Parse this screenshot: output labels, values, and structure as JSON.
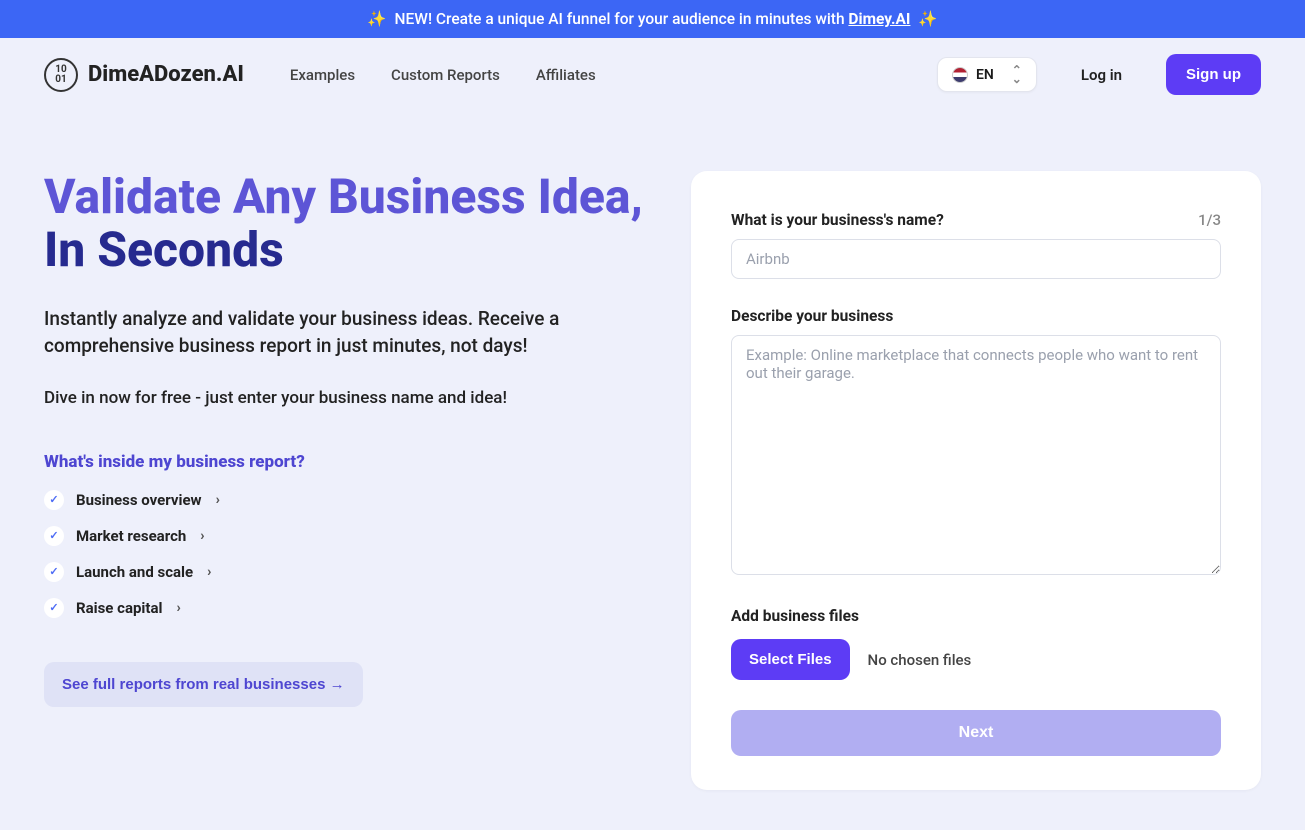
{
  "banner": {
    "prefix": "NEW! Create a unique AI funnel for your audience in minutes with ",
    "link_text": "Dimey.AI",
    "sparkle": "✨"
  },
  "brand": {
    "name": "DimeADozen.AI",
    "logo_text": "10\n01"
  },
  "nav": {
    "examples": "Examples",
    "custom_reports": "Custom Reports",
    "affiliates": "Affiliates"
  },
  "header_actions": {
    "lang_label": "EN",
    "login": "Log in",
    "signup": "Sign up"
  },
  "hero": {
    "title_a": "Validate Any Business Idea, ",
    "title_b": "In Seconds",
    "subtitle": "Instantly analyze and validate your business ideas. Receive a comprehensive business report in just minutes, not days!",
    "cta_line": "Dive in now for free - just enter your business name and idea!",
    "inside_heading": "What's inside my business report?",
    "features": [
      {
        "label": "Business overview"
      },
      {
        "label": "Market research"
      },
      {
        "label": "Launch and scale"
      },
      {
        "label": "Raise capital"
      }
    ],
    "see_full": "See full reports from real businesses →"
  },
  "form": {
    "q1_label": "What is your business's name?",
    "step_indicator": "1/3",
    "q1_placeholder": "Airbnb",
    "q2_label": "Describe your business",
    "q2_placeholder": "Example: Online marketplace that connects people who want to rent out their garage.",
    "files_label": "Add business files",
    "select_files": "Select Files",
    "files_status": "No chosen files",
    "next": "Next"
  }
}
